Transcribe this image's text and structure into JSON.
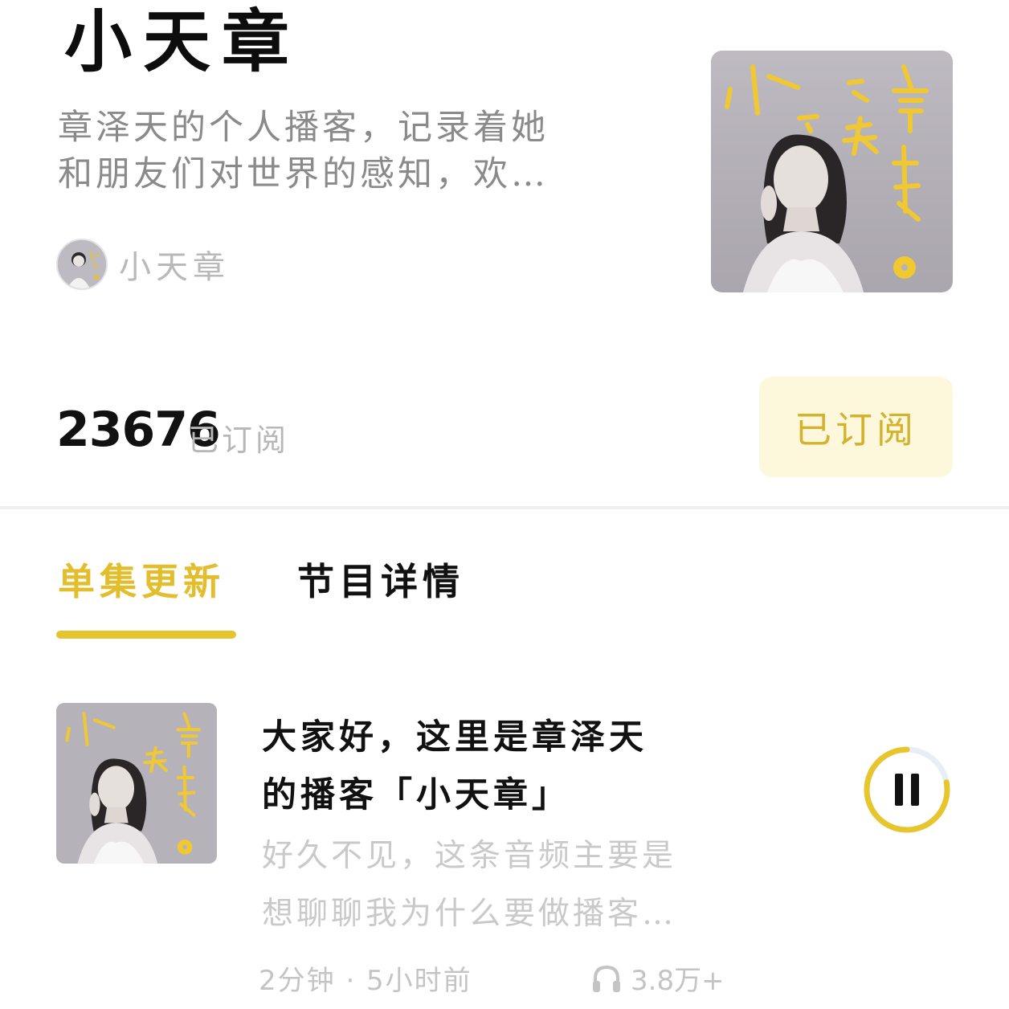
{
  "podcast": {
    "title": "小天章",
    "description_lines": [
      "章泽天的个人播客，记录着她",
      "和朋友们对世界的感知，欢…"
    ],
    "author": "小天章",
    "subscriber_count": "23676",
    "subscriber_label": "已订阅",
    "subscribe_button": "已订阅",
    "cover_art": "portrait-cover",
    "accent_color": "#e5c42e"
  },
  "tabs": [
    {
      "label": "单集更新",
      "active": true
    },
    {
      "label": "节目详情",
      "active": false
    }
  ],
  "episodes": [
    {
      "title_lines": [
        "大家好，这里是章泽天",
        "的播客「小天章」"
      ],
      "desc_lines": [
        "好久不见，这条音频主要是",
        "想聊聊我为什么要做播客…"
      ],
      "meta": "2分钟 · 5小时前",
      "plays": "3.8万+",
      "play_state": "paused-icon-shown",
      "progress": 0.78
    }
  ]
}
